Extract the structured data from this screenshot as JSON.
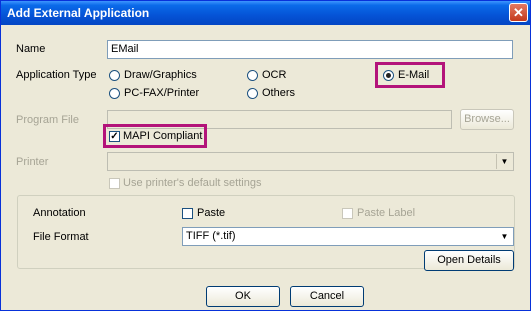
{
  "window": {
    "title": "Add External Application",
    "close_glyph": "✕"
  },
  "name": {
    "label": "Name",
    "value": "EMail"
  },
  "app_type": {
    "label": "Application Type",
    "options": [
      "Draw/Graphics",
      "OCR",
      "E-Mail",
      "PC-FAX/Printer",
      "Others"
    ],
    "selected": "E-Mail"
  },
  "program_file": {
    "label": "Program File",
    "value": "",
    "browse_label": "Browse..."
  },
  "mapi": {
    "label": "MAPI Compliant",
    "checked": true
  },
  "printer": {
    "label": "Printer",
    "value": "",
    "default_settings_label": "Use printer's default settings"
  },
  "annotation": {
    "label": "Annotation",
    "paste_label": "Paste",
    "paste_label_label": "Paste Label"
  },
  "file_format": {
    "label": "File Format",
    "value": "TIFF (*.tif)",
    "open_details_label": "Open Details"
  },
  "buttons": {
    "ok": "OK",
    "cancel": "Cancel"
  },
  "colors": {
    "highlight": "#b3137a",
    "title_bar": "#0553d6",
    "dialog_bg": "#ece9d8"
  }
}
